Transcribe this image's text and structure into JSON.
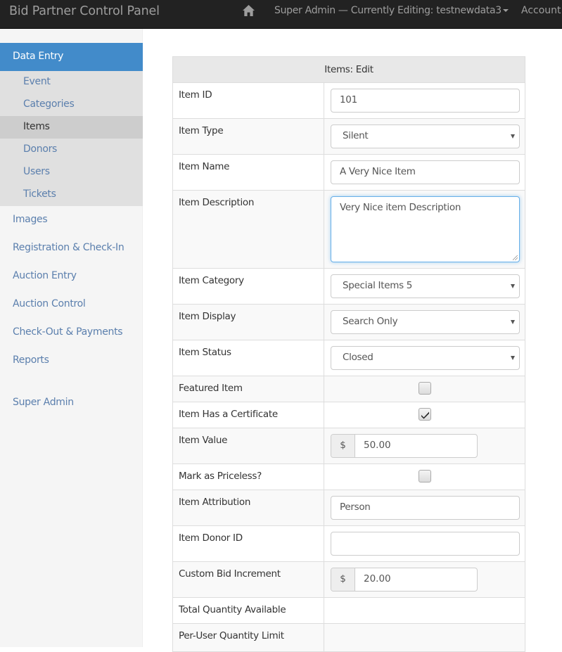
{
  "navbar": {
    "brand": "Bid Partner Control Panel",
    "home_icon": "home-icon",
    "editing_label": "Super Admin — Currently Editing: testnewdata3",
    "account_label": "Account"
  },
  "sidebar": {
    "section": "Data Entry",
    "sub_items": [
      {
        "label": "Event",
        "active": false
      },
      {
        "label": "Categories",
        "active": false
      },
      {
        "label": "Items",
        "active": true
      },
      {
        "label": "Donors",
        "active": false
      },
      {
        "label": "Users",
        "active": false
      },
      {
        "label": "Tickets",
        "active": false
      }
    ],
    "items": [
      {
        "label": "Images"
      },
      {
        "label": "Registration & Check-In"
      },
      {
        "label": "Auction Entry"
      },
      {
        "label": "Auction Control"
      },
      {
        "label": "Check-Out & Payments"
      },
      {
        "label": "Reports"
      },
      {
        "label": "Super Admin"
      }
    ]
  },
  "form": {
    "title": "Items: Edit",
    "fields": {
      "item_id": {
        "label": "Item ID",
        "value": "101"
      },
      "item_type": {
        "label": "Item Type",
        "value": "Silent"
      },
      "item_name": {
        "label": "Item Name",
        "value": "A Very Nice Item"
      },
      "item_description": {
        "label": "Item Description",
        "value": "Very Nice item Description"
      },
      "item_category": {
        "label": "Item Category",
        "value": "Special Items 5"
      },
      "item_display": {
        "label": "Item Display",
        "value": "Search Only"
      },
      "item_status": {
        "label": "Item Status",
        "value": "Closed"
      },
      "featured_item": {
        "label": "Featured Item",
        "checked": false
      },
      "item_certificate": {
        "label": "Item Has a Certificate",
        "checked": true
      },
      "item_value": {
        "label": "Item Value",
        "prefix": "$",
        "value": "50.00"
      },
      "priceless": {
        "label": "Mark as Priceless?",
        "checked": false
      },
      "item_attribution": {
        "label": "Item Attribution",
        "value": "Person"
      },
      "item_donor_id": {
        "label": "Item Donor ID",
        "value": ""
      },
      "bid_increment": {
        "label": "Custom Bid Increment",
        "prefix": "$",
        "value": "20.00"
      },
      "total_quantity": {
        "label": "Total Quantity Available"
      },
      "per_user_limit": {
        "label": "Per-User Quantity Limit"
      }
    }
  },
  "colors": {
    "navbar_bg": "#222222",
    "accent": "#428bca",
    "link": "#5b7fad"
  }
}
